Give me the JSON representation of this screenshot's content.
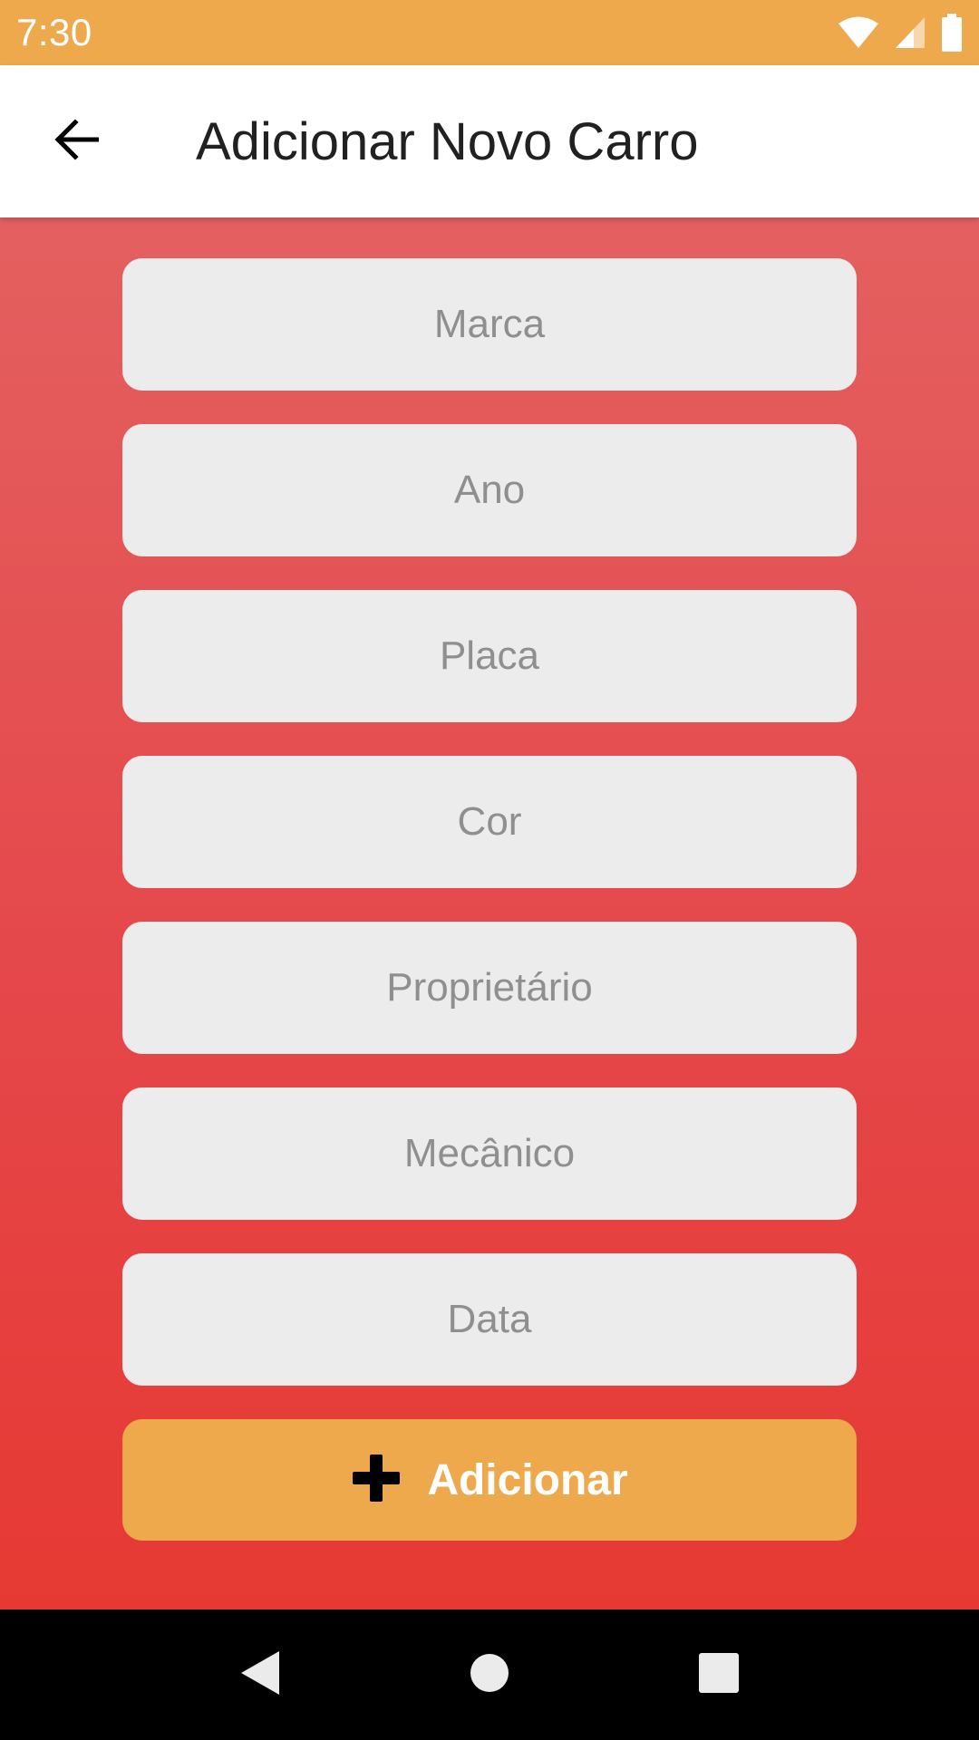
{
  "status_bar": {
    "time": "7:30",
    "icons": [
      "wifi-icon",
      "signal-icon",
      "battery-icon"
    ],
    "background": "#EEA94C"
  },
  "app_bar": {
    "title": "Adicionar Novo Carro",
    "back_icon": "arrow-left-icon"
  },
  "form": {
    "fields": [
      {
        "name": "marca",
        "placeholder": "Marca",
        "value": ""
      },
      {
        "name": "ano",
        "placeholder": "Ano",
        "value": ""
      },
      {
        "name": "placa",
        "placeholder": "Placa",
        "value": ""
      },
      {
        "name": "cor",
        "placeholder": "Cor",
        "value": ""
      },
      {
        "name": "proprietario",
        "placeholder": "Proprietário",
        "value": ""
      },
      {
        "name": "mecanico",
        "placeholder": "Mecânico",
        "value": ""
      },
      {
        "name": "data",
        "placeholder": "Data",
        "value": ""
      }
    ],
    "submit": {
      "label": "Adicionar",
      "icon": "plus-icon",
      "color": "#EEA94C"
    }
  },
  "nav_bar": {
    "buttons": [
      "back-triangle-icon",
      "home-circle-icon",
      "recents-square-icon"
    ]
  },
  "colors": {
    "accent": "#EEA94C",
    "gradient_top": "#E46060",
    "gradient_bottom": "#E63933",
    "field_bg": "#ECECEC",
    "placeholder": "#8F8F8F"
  }
}
